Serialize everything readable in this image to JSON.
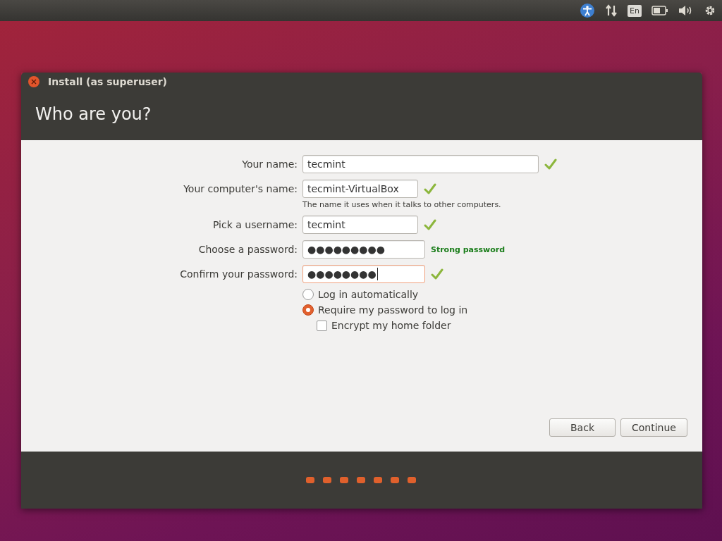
{
  "top_panel": {
    "keyboard_layout": "En"
  },
  "window": {
    "title": "Install (as superuser)",
    "heading": "Who are you?"
  },
  "fields": [
    {
      "kind": "wide",
      "label": "Your name:",
      "value": "tecmint",
      "valid": true,
      "focused": false
    },
    {
      "kind": "text",
      "label": "Your computer's name:",
      "value": "tecmint-VirtualBox",
      "valid": true,
      "focused": false,
      "hint": "The name it uses when it talks to other computers."
    },
    {
      "kind": "text",
      "label": "Pick a username:",
      "value": "tecmint",
      "valid": true,
      "focused": false
    },
    {
      "kind": "password",
      "label": "Choose a password:",
      "value": "●●●●●●●●●",
      "valid": false,
      "focused": false,
      "strength": "Strong password"
    },
    {
      "kind": "password",
      "label": "Confirm your password:",
      "value": "●●●●●●●●",
      "valid": true,
      "focused": true
    }
  ],
  "login_options": [
    {
      "label": "Log in automatically",
      "selected": false
    },
    {
      "label": "Require my password to log in",
      "selected": true
    }
  ],
  "encrypt": {
    "label": "Encrypt my home folder",
    "checked": false
  },
  "buttons": [
    "Back",
    "Continue"
  ]
}
